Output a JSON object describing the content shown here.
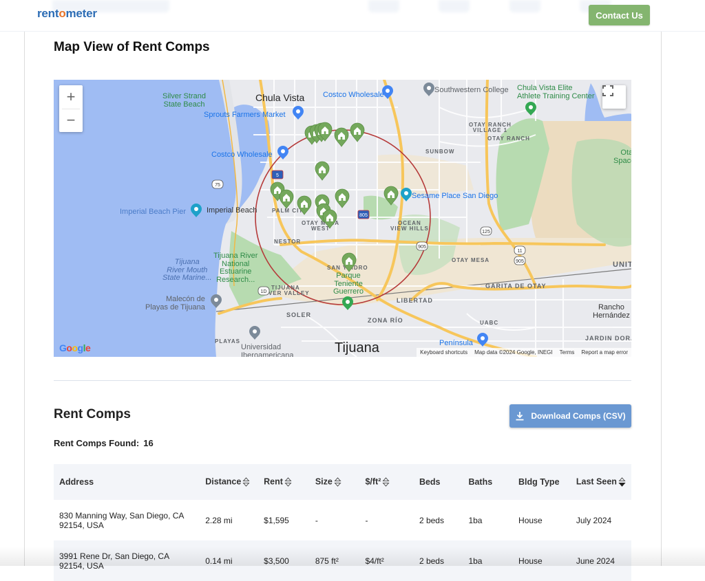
{
  "header": {
    "logo_pre": "rent",
    "logo_o": "o",
    "logo_post": "meter",
    "contact_label": "Contact Us"
  },
  "map_section": {
    "title": "Map View of Rent Comps",
    "zoom_in": "+",
    "zoom_out": "−",
    "labels": {
      "chula_vista": "Chula Vista",
      "silver_strand": "Silver Strand\nState Beach",
      "sprouts": "Sprouts Farmers Market",
      "costco1": "Costco Wholesale",
      "costco2": "Costco Wholesale",
      "southwestern": "Southwestern College",
      "elite": "Chula Vista Elite\nAthlete Training Center",
      "otay_village": "OTAY RANCH\nVILLAGE 1",
      "otay_ranch": "OTAY RANCH",
      "sunbow": "SUNBOW",
      "otay_open": "Otay Op\nSpace Pre",
      "sesame": "Sesame Place San Diego",
      "imperial_pier": "Imperial Beach Pier",
      "imperial_beach": "Imperial Beach",
      "palm_city": "PALM CITY",
      "otay_mesa_west": "OTAY MESA\nWEST",
      "ocean_view": "OCEAN\nVIEW HILLS",
      "nestor": "NESTOR",
      "tj_river_mouth": "Tijuana\nRiver Mouth\nState Marine...",
      "tj_estuarine": "Tijuana River\nNational\nEstuarine\nResearch...",
      "san_ysidro": "SAN YSIDRO",
      "parque": "Parque\nTeniente\nGuerrero",
      "otay_mesa": "OTAY MESA",
      "united": "UNIT",
      "tj_river_valley": "TIJUANA\nRIVER VALLEY",
      "garita": "GARITA DE OTAY",
      "libertad": "LIBERTAD",
      "malecon": "Malecón de\nPlayas de Tijuana",
      "soler": "SOLER",
      "zona_rio": "ZONA RÍO",
      "uabc": "UABC",
      "rancho": "Rancho\nHernández",
      "playas": "PLAYAS",
      "universidad": "Universidad\nIberoamericana",
      "tijuana": "Tijuana",
      "peninsula": "Península",
      "jardin": "JARDIN DORA"
    },
    "shields": [
      "75",
      "5",
      "805",
      "905",
      "125",
      "11",
      "905",
      "125",
      "1D"
    ],
    "google_logo": "Google",
    "footer": {
      "shortcuts": "Keyboard shortcuts",
      "attribution": "Map data ©2024 Google, INEGI",
      "terms": "Terms",
      "report": "Report a map error"
    },
    "marker_count": 16
  },
  "comps_section": {
    "title": "Rent Comps",
    "found_label": "Rent Comps Found:",
    "found_count": "16",
    "download_label": "Download Comps (CSV)",
    "columns": [
      {
        "label": "Address",
        "sortable": false
      },
      {
        "label": "Distance",
        "sortable": true
      },
      {
        "label": "Rent",
        "sortable": true
      },
      {
        "label": "Size",
        "sortable": true
      },
      {
        "label": "$/ft²",
        "sortable": true
      },
      {
        "label": "Beds",
        "sortable": false
      },
      {
        "label": "Baths",
        "sortable": false
      },
      {
        "label": "Bldg Type",
        "sortable": false
      },
      {
        "label": "Last Seen",
        "sortable": true,
        "sorted": "desc"
      }
    ],
    "rows": [
      {
        "address": "830 Manning Way, San Diego, CA 92154, USA",
        "distance": "2.28 mi",
        "rent": "$1,595",
        "size": "-",
        "ppsf": "-",
        "beds": "2 beds",
        "baths": "1ba",
        "type": "House",
        "last_seen": "July 2024"
      },
      {
        "address": "3991 Rene Dr, San Diego, CA 92154, USA",
        "distance": "0.14 mi",
        "rent": "$3,500",
        "size": "875 ft²",
        "ppsf": "$4/ft²",
        "beds": "2 beds",
        "baths": "1ba",
        "type": "House",
        "last_seen": "June 2024"
      }
    ]
  },
  "colors": {
    "brand_blue": "#2d6db5",
    "brand_orange": "#e8752a",
    "contact_green": "#84b56f",
    "download_blue": "#6a98d2",
    "marker_green": "#74a85c",
    "radius_red": "#b53a3a"
  }
}
